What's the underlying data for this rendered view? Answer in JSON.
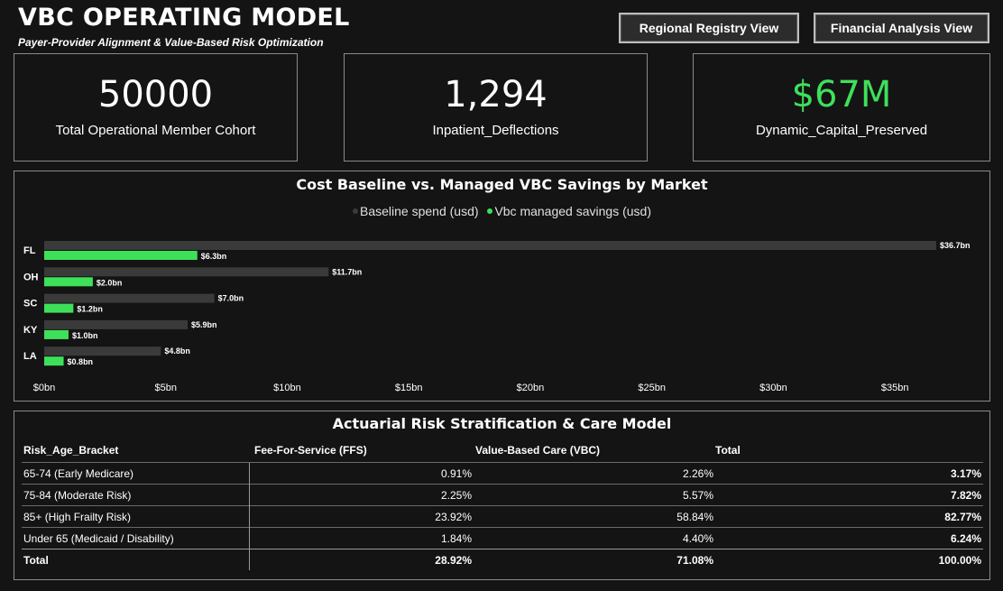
{
  "header": {
    "title": "VBC OPERATING MODEL",
    "subtitle": "Payer-Provider Alignment & Value-Based Risk Optimization"
  },
  "nav": {
    "regional_label": "Regional Registry View",
    "financial_label": "Financial Analysis View"
  },
  "kpis": [
    {
      "value": "50000",
      "label": "Total Operational Member Cohort",
      "color": "#ffffff"
    },
    {
      "value": "1,294",
      "label": "Inpatient_Deflections",
      "color": "#ffffff"
    },
    {
      "value": "$67M",
      "label": "Dynamic_Capital_Preserved",
      "color": "#3ee05a"
    }
  ],
  "colors": {
    "baseline": "#3a3a3a",
    "savings": "#3ee05a",
    "background": "#141414"
  },
  "chart_data": {
    "type": "bar",
    "orientation": "horizontal",
    "title": "Cost Baseline vs. Managed VBC Savings by Market",
    "categories": [
      "FL",
      "OH",
      "SC",
      "KY",
      "LA"
    ],
    "series": [
      {
        "name": "Baseline spend (usd)",
        "values": [
          36.7,
          11.7,
          7.0,
          5.9,
          4.8
        ],
        "labels": [
          "$36.7bn",
          "$11.7bn",
          "$7.0bn",
          "$5.9bn",
          "$4.8bn"
        ]
      },
      {
        "name": "Vbc managed savings (usd)",
        "values": [
          6.3,
          2.0,
          1.2,
          1.0,
          0.8
        ],
        "labels": [
          "$6.3bn",
          "$2.0bn",
          "$1.2bn",
          "$1.0bn",
          "$0.8bn"
        ]
      }
    ],
    "xlim": [
      0,
      36.7
    ],
    "xticks": [
      0,
      5,
      10,
      15,
      20,
      25,
      30,
      35
    ],
    "xtick_labels": [
      "$0bn",
      "$5bn",
      "$10bn",
      "$15bn",
      "$20bn",
      "$25bn",
      "$30bn",
      "$35bn"
    ],
    "grid": false,
    "legend_position": "top-center"
  },
  "table": {
    "title": "Actuarial Risk Stratification & Care Model",
    "headers": [
      "Risk_Age_Bracket",
      "Fee-For-Service (FFS)",
      "Value-Based Care (VBC)",
      "Total"
    ],
    "rows": [
      [
        "65-74 (Early Medicare)",
        "0.91%",
        "2.26%",
        "3.17%"
      ],
      [
        "75-84 (Moderate Risk)",
        "2.25%",
        "5.57%",
        "7.82%"
      ],
      [
        "85+ (High Frailty Risk)",
        "23.92%",
        "58.84%",
        "82.77%"
      ],
      [
        "Under 65 (Medicaid / Disability)",
        "1.84%",
        "4.40%",
        "6.24%"
      ]
    ],
    "total": [
      "Total",
      "28.92%",
      "71.08%",
      "100.00%"
    ]
  }
}
